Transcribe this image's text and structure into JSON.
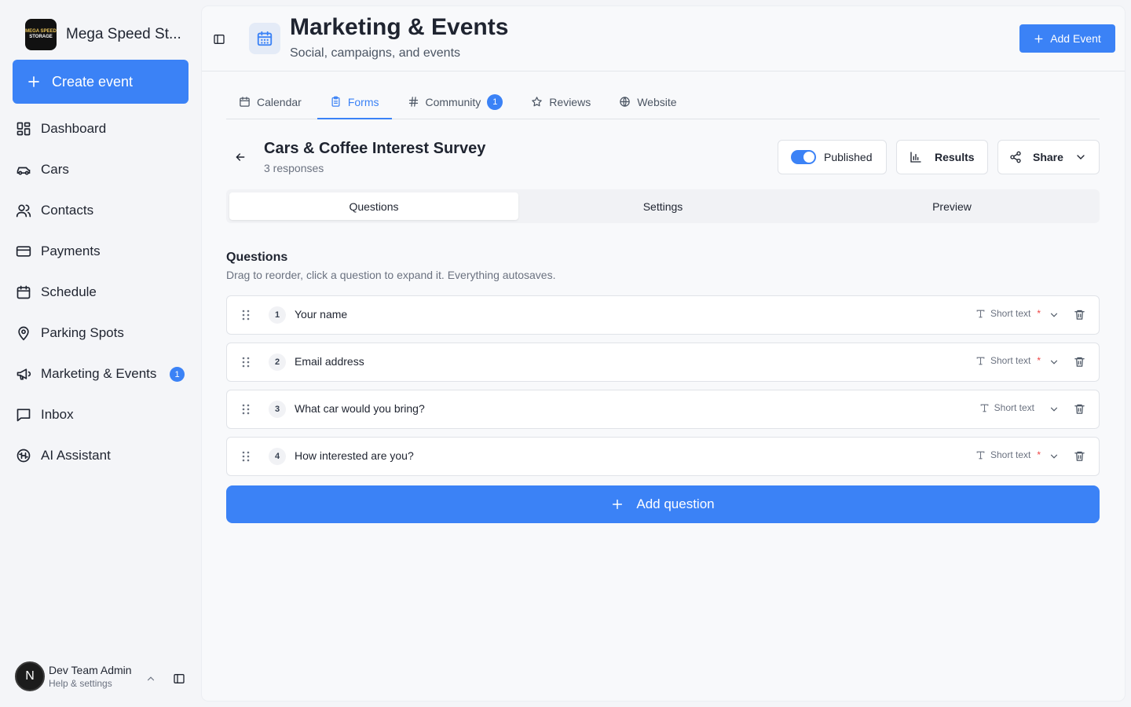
{
  "brand": {
    "name": "Mega Speed St...",
    "logo_line1": "MEGA SPEED",
    "logo_line2": "STORAGE"
  },
  "sidebar": {
    "create_label": "Create event",
    "items": [
      {
        "label": "Dashboard",
        "icon": "dashboard-icon"
      },
      {
        "label": "Cars",
        "icon": "car-icon"
      },
      {
        "label": "Contacts",
        "icon": "users-icon"
      },
      {
        "label": "Payments",
        "icon": "credit-card-icon"
      },
      {
        "label": "Schedule",
        "icon": "calendar-icon"
      },
      {
        "label": "Parking Spots",
        "icon": "map-pin-icon"
      },
      {
        "label": "Marketing & Events",
        "icon": "megaphone-icon",
        "badge": "1"
      },
      {
        "label": "Inbox",
        "icon": "inbox-icon"
      },
      {
        "label": "AI Assistant",
        "icon": "ai-icon"
      }
    ],
    "user": {
      "initial": "N",
      "name": "Dev Team Admin",
      "subtitle": "Help & settings"
    }
  },
  "header": {
    "title": "Marketing & Events",
    "subtitle": "Social, campaigns, and events",
    "add_event_label": "Add Event"
  },
  "tabs": [
    {
      "label": "Calendar",
      "icon": "calendar-icon"
    },
    {
      "label": "Forms",
      "icon": "clipboard-icon",
      "active": true
    },
    {
      "label": "Community",
      "icon": "hash-icon",
      "badge": "1"
    },
    {
      "label": "Reviews",
      "icon": "star-icon"
    },
    {
      "label": "Website",
      "icon": "globe-icon"
    }
  ],
  "form": {
    "title": "Cars & Coffee Interest Survey",
    "responses": "3 responses",
    "published_label": "Published",
    "published": true,
    "results_label": "Results",
    "share_label": "Share"
  },
  "segments": [
    "Questions",
    "Settings",
    "Preview"
  ],
  "questions_section": {
    "heading": "Questions",
    "help": "Drag to reorder, click a question to expand it. Everything autosaves.",
    "add_label": "Add question"
  },
  "questions": [
    {
      "num": "1",
      "label": "Your name",
      "type": "Short text",
      "required": "*"
    },
    {
      "num": "2",
      "label": "Email address",
      "type": "Short text",
      "required": "*"
    },
    {
      "num": "3",
      "label": "What car would you bring?",
      "type": "Short text",
      "required": ""
    },
    {
      "num": "4",
      "label": "How interested are you?",
      "type": "Short text",
      "required": "*"
    }
  ],
  "colors": {
    "accent": "#3b82f6",
    "required": "#ef4444"
  }
}
